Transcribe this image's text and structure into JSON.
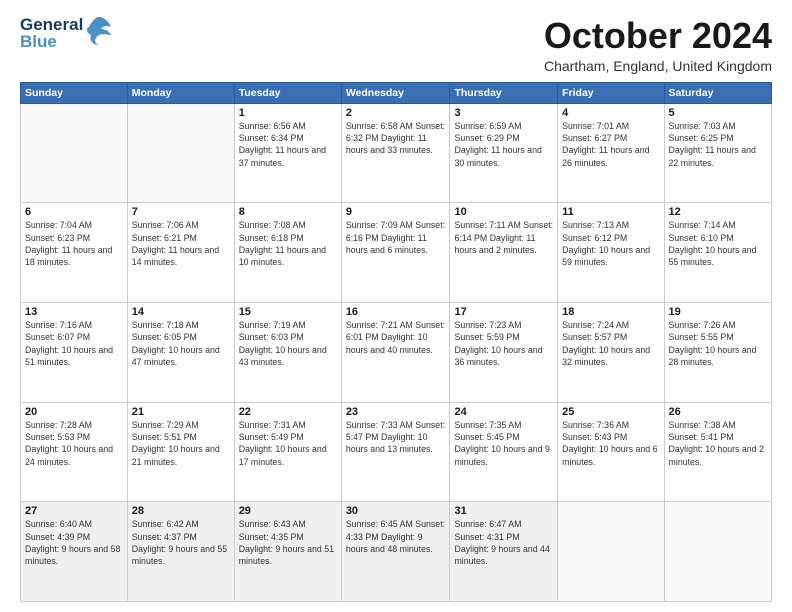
{
  "logo": {
    "part1": "General",
    "part2": "Blue"
  },
  "title": "October 2024",
  "location": "Chartham, England, United Kingdom",
  "days_of_week": [
    "Sunday",
    "Monday",
    "Tuesday",
    "Wednesday",
    "Thursday",
    "Friday",
    "Saturday"
  ],
  "weeks": [
    [
      {
        "day": "",
        "info": ""
      },
      {
        "day": "",
        "info": ""
      },
      {
        "day": "1",
        "info": "Sunrise: 6:56 AM\nSunset: 6:34 PM\nDaylight: 11 hours\nand 37 minutes."
      },
      {
        "day": "2",
        "info": "Sunrise: 6:58 AM\nSunset: 6:32 PM\nDaylight: 11 hours\nand 33 minutes."
      },
      {
        "day": "3",
        "info": "Sunrise: 6:59 AM\nSunset: 6:29 PM\nDaylight: 11 hours\nand 30 minutes."
      },
      {
        "day": "4",
        "info": "Sunrise: 7:01 AM\nSunset: 6:27 PM\nDaylight: 11 hours\nand 26 minutes."
      },
      {
        "day": "5",
        "info": "Sunrise: 7:03 AM\nSunset: 6:25 PM\nDaylight: 11 hours\nand 22 minutes."
      }
    ],
    [
      {
        "day": "6",
        "info": "Sunrise: 7:04 AM\nSunset: 6:23 PM\nDaylight: 11 hours\nand 18 minutes."
      },
      {
        "day": "7",
        "info": "Sunrise: 7:06 AM\nSunset: 6:21 PM\nDaylight: 11 hours\nand 14 minutes."
      },
      {
        "day": "8",
        "info": "Sunrise: 7:08 AM\nSunset: 6:18 PM\nDaylight: 11 hours\nand 10 minutes."
      },
      {
        "day": "9",
        "info": "Sunrise: 7:09 AM\nSunset: 6:16 PM\nDaylight: 11 hours\nand 6 minutes."
      },
      {
        "day": "10",
        "info": "Sunrise: 7:11 AM\nSunset: 6:14 PM\nDaylight: 11 hours\nand 2 minutes."
      },
      {
        "day": "11",
        "info": "Sunrise: 7:13 AM\nSunset: 6:12 PM\nDaylight: 10 hours\nand 59 minutes."
      },
      {
        "day": "12",
        "info": "Sunrise: 7:14 AM\nSunset: 6:10 PM\nDaylight: 10 hours\nand 55 minutes."
      }
    ],
    [
      {
        "day": "13",
        "info": "Sunrise: 7:16 AM\nSunset: 6:07 PM\nDaylight: 10 hours\nand 51 minutes."
      },
      {
        "day": "14",
        "info": "Sunrise: 7:18 AM\nSunset: 6:05 PM\nDaylight: 10 hours\nand 47 minutes."
      },
      {
        "day": "15",
        "info": "Sunrise: 7:19 AM\nSunset: 6:03 PM\nDaylight: 10 hours\nand 43 minutes."
      },
      {
        "day": "16",
        "info": "Sunrise: 7:21 AM\nSunset: 6:01 PM\nDaylight: 10 hours\nand 40 minutes."
      },
      {
        "day": "17",
        "info": "Sunrise: 7:23 AM\nSunset: 5:59 PM\nDaylight: 10 hours\nand 36 minutes."
      },
      {
        "day": "18",
        "info": "Sunrise: 7:24 AM\nSunset: 5:57 PM\nDaylight: 10 hours\nand 32 minutes."
      },
      {
        "day": "19",
        "info": "Sunrise: 7:26 AM\nSunset: 5:55 PM\nDaylight: 10 hours\nand 28 minutes."
      }
    ],
    [
      {
        "day": "20",
        "info": "Sunrise: 7:28 AM\nSunset: 5:53 PM\nDaylight: 10 hours\nand 24 minutes."
      },
      {
        "day": "21",
        "info": "Sunrise: 7:29 AM\nSunset: 5:51 PM\nDaylight: 10 hours\nand 21 minutes."
      },
      {
        "day": "22",
        "info": "Sunrise: 7:31 AM\nSunset: 5:49 PM\nDaylight: 10 hours\nand 17 minutes."
      },
      {
        "day": "23",
        "info": "Sunrise: 7:33 AM\nSunset: 5:47 PM\nDaylight: 10 hours\nand 13 minutes."
      },
      {
        "day": "24",
        "info": "Sunrise: 7:35 AM\nSunset: 5:45 PM\nDaylight: 10 hours\nand 9 minutes."
      },
      {
        "day": "25",
        "info": "Sunrise: 7:36 AM\nSunset: 5:43 PM\nDaylight: 10 hours\nand 6 minutes."
      },
      {
        "day": "26",
        "info": "Sunrise: 7:38 AM\nSunset: 5:41 PM\nDaylight: 10 hours\nand 2 minutes."
      }
    ],
    [
      {
        "day": "27",
        "info": "Sunrise: 6:40 AM\nSunset: 4:39 PM\nDaylight: 9 hours\nand 58 minutes."
      },
      {
        "day": "28",
        "info": "Sunrise: 6:42 AM\nSunset: 4:37 PM\nDaylight: 9 hours\nand 55 minutes."
      },
      {
        "day": "29",
        "info": "Sunrise: 6:43 AM\nSunset: 4:35 PM\nDaylight: 9 hours\nand 51 minutes."
      },
      {
        "day": "30",
        "info": "Sunrise: 6:45 AM\nSunset: 4:33 PM\nDaylight: 9 hours\nand 48 minutes."
      },
      {
        "day": "31",
        "info": "Sunrise: 6:47 AM\nSunset: 4:31 PM\nDaylight: 9 hours\nand 44 minutes."
      },
      {
        "day": "",
        "info": ""
      },
      {
        "day": "",
        "info": ""
      }
    ]
  ]
}
